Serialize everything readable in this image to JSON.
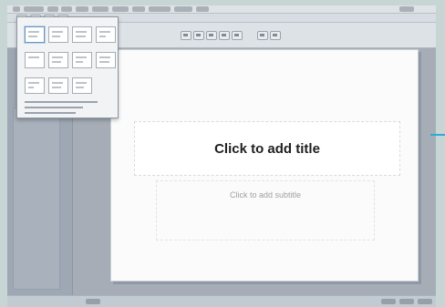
{
  "slide": {
    "title_placeholder": "Click to add title",
    "subtitle_placeholder": "Click to add subtitle"
  },
  "colors": {
    "accent": "#2eaad6"
  },
  "icons": [
    "menu-icon",
    "undo-icon",
    "redo-icon",
    "layout-icon",
    "zoom-icon"
  ]
}
